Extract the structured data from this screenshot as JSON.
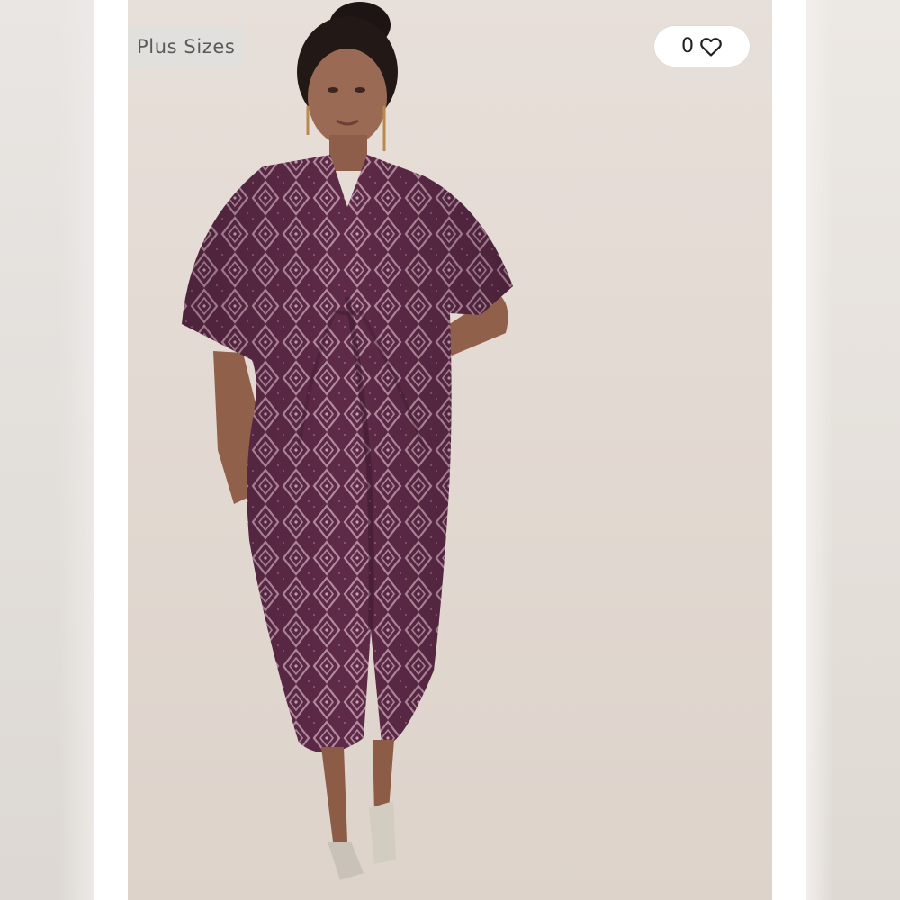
{
  "listing": {
    "category_badge": "Plus Sizes",
    "like_count": "0"
  },
  "icons": {
    "like": "heart-outline-icon"
  },
  "colors": {
    "dress": "#5e2a48",
    "background": "#e3dad3"
  }
}
